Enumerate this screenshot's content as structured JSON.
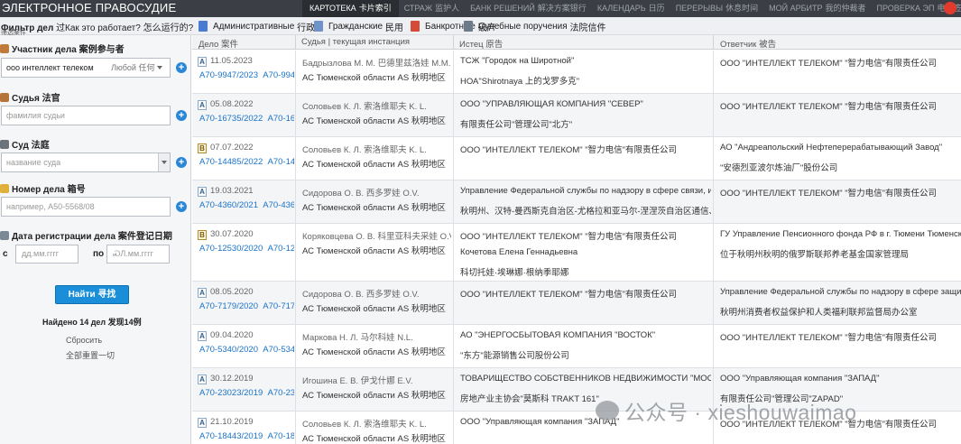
{
  "app": {
    "brand": "ЭЛЕКТРОННОЕ ПРАВОСУДИЕ",
    "topnav": [
      {
        "label": "КАРТОТЕКА",
        "zh": "卡片索引",
        "active": true
      },
      {
        "label": "СТРАЖ",
        "zh": "监护人",
        "active": false
      },
      {
        "label": "БАНК РЕШЕНИЙ",
        "zh": "解决方案银行",
        "active": false
      },
      {
        "label": "КАЛЕНДАРЬ",
        "zh": "日历",
        "active": false
      },
      {
        "label": "ПЕРЕРЫВЫ",
        "zh": "休息时间",
        "active": false
      },
      {
        "label": "МОЙ АРБИТР",
        "zh": "我的仲裁者",
        "active": false
      },
      {
        "label": "ПРОВЕРКА ЭП",
        "zh": "电子签名验证",
        "active": false
      }
    ]
  },
  "filterbar": {
    "title": "Фильтр дел",
    "title_zh": "过",
    "subtitle": "筛选案件",
    "howit": "Как это работает?",
    "howit_zh": "怎么运行的?",
    "chips": [
      {
        "label": "Административные",
        "zh": "行政",
        "color": "#4a7bd0"
      },
      {
        "label": "Гражданские",
        "zh": "民用",
        "color": "#6f93c9"
      },
      {
        "label": "Банкротные",
        "zh": "破产",
        "color": "#d64a3a"
      },
      {
        "label": "Судебные поручения",
        "zh": "法院信件",
        "color": "#6c7a8a"
      }
    ]
  },
  "sidebar": {
    "participant_label": "Участник дела",
    "participant_zh": "案例参与者",
    "participant_value": "ооо интеллект телеком",
    "participant_role": "Любой",
    "participant_role_zh": "任何",
    "judge_label": "Судья",
    "judge_zh": "法官",
    "judge_placeholder": "фамилия судьи",
    "court_label": "Суд",
    "court_zh": "法庭",
    "court_placeholder": "название суда",
    "casenum_label": "Номер дела",
    "casenum_zh": "箱号",
    "casenum_placeholder": "например, А50-5568/08",
    "date_label": "Дата регистрации дела",
    "date_zh": "案件登记日期",
    "date_from": "с",
    "date_to": "по",
    "date_placeholder": "дд.мм.гггг",
    "date_to_placeholder": "ᏍЛ.мм.гггг",
    "find_button": "Найти",
    "find_zh": "寻找",
    "found": "Найдено 14 дел",
    "found_zh": "发现14例",
    "reset": "Сбросить",
    "reset_zh": "全部重置一切",
    "reset_zh2": "全部重置一切"
  },
  "table": {
    "headers": [
      {
        "label": "Дело",
        "zh": "案件"
      },
      {
        "label": "Судья | текущая инстанция",
        "zh": ""
      },
      {
        "label": "Истец",
        "zh": "原告"
      },
      {
        "label": "Ответчик",
        "zh": "被告"
      }
    ],
    "rows": [
      {
        "type": "A",
        "date": "11.05.2023",
        "case": "А70-9947/2023",
        "case_dup": "А70-9947/2023",
        "judge": "Бадрызлова М. М.",
        "judge_zh": "巴德里兹洛娃 M.M.",
        "court": "АС Тюменской области",
        "court_zh": "AS 秋明地区",
        "plaintiff": [
          "ТСЖ \"Городок на Широтной\"",
          "НОА\"Shirotnaya 上的戈罗多克\""
        ],
        "defendant": [
          "ООО \"ИНТЕЛЛЕКТ ТЕЛЕКОМ\" \"智力电信\"有限责任公司"
        ]
      },
      {
        "type": "A",
        "date": "05.08.2022",
        "case": "А70-16735/2022",
        "case_dup": "А70-16735/2022",
        "judge": "Соловьев К. Л.",
        "judge_zh": "索洛维耶夫 K. L.",
        "court": "АС Тюменской области",
        "court_zh": "AS 秋明地区",
        "plaintiff": [
          "ООО \"УПРАВЛЯЮЩАЯ КОМПАНИЯ \"СЕВЕР\"",
          "有限责任公司\"管理公司\"北方\""
        ],
        "defendant": [
          "ООО \"ИНТЕЛЛЕКТ ТЕЛЕКОМ\" \"智力电信\"有限责任公司"
        ]
      },
      {
        "type": "B",
        "date": "07.07.2022",
        "case": "А70-14485/2022",
        "case_dup": "А70-14485/2022",
        "judge": "Соловьев К. Л.",
        "judge_zh": "索洛维耶夫 K. L.",
        "court": "АС Тюменской области",
        "court_zh": "AS 秋明地区",
        "plaintiff": [
          "ООО \"ИНТЕЛЛЕКТ ТЕЛЕКОМ\" \"智力电信\"有限责任公司"
        ],
        "defendant": [
          "АО \"Андреапольский Нефтеперерабатывающий Завод\"",
          "\"安德烈亚波尔炼油厂\"股份公司"
        ]
      },
      {
        "type": "A",
        "date": "19.03.2021",
        "case": "А70-4360/2021",
        "case_dup": "А70-4360/2021",
        "judge": "Сидорова О. В.",
        "judge_zh": "西多罗娃 O.V.",
        "court": "АС Тюменской области",
        "court_zh": "AS 秋明地区",
        "plaintiff": [
          "Управление Федеральной службы по надзору в сфере связи, информ",
          "秋明州、汉特-曼西斯克自治区-尤格拉和亚马尔-涅涅茨自治区通信、信"
        ],
        "defendant": [
          "ООО \"ИНТЕЛЛЕКТ ТЕЛЕКОМ\" \"智力电信\"有限责任公司"
        ]
      },
      {
        "type": "B",
        "date": "30.07.2020",
        "case": "А70-12530/2020",
        "case_dup": "А70-12530/2020",
        "judge": "Коряковцева О. В.",
        "judge_zh": "科里亚科夫采娃 O.V.",
        "court": "АС Тюменской области",
        "court_zh": "AS 秋明地区",
        "plaintiff": [
          "ООО \"ИНТЕЛЛЕКТ ТЕЛЕКОМ\" \"智力电信\"有限责任公司",
          "Кочетова Елена Геннадьевна",
          "科切托娃·埃琳娜·根纳季耶娜"
        ],
        "defendant": [
          "ГУ Управление Пенсионного фонда РФ в г. Тюмени Тюменской о",
          "位于秋明州秋明的俄罗斯联邦养老基金国家管理局"
        ]
      },
      {
        "type": "A",
        "date": "08.05.2020",
        "case": "А70-7179/2020",
        "case_dup": "А70-7179/2020",
        "judge": "Сидорова О. В.",
        "judge_zh": "西多罗娃 O.V.",
        "court": "АС Тюменской области",
        "court_zh": "AS 秋明地区",
        "plaintiff": [
          "ООО \"ИНТЕЛЛЕКТ ТЕЛЕКОМ\" \"智力电信\"有限责任公司"
        ],
        "defendant": [
          "Управление Федеральной службы по надзору в сфере защиты пр",
          "秋明州消费者权益保护和人类福利联邦监督局办公室"
        ]
      },
      {
        "type": "A",
        "date": "09.04.2020",
        "case": "А70-5340/2020",
        "case_dup": "А70-5340/2020",
        "judge": "Маркова Н. Л.",
        "judge_zh": "马尔科娃 N.L.",
        "court": "АС Тюменской области",
        "court_zh": "AS 秋明地区",
        "plaintiff": [
          "АО \"ЭНЕРГОСБЫТОВАЯ КОМПАНИЯ \"ВОСТОК\"",
          "\"东方\"能源销售公司股份公司"
        ],
        "defendant": [
          "ООО \"ИНТЕЛЛЕКТ ТЕЛЕКОМ\" \"智力电信\"有限责任公司"
        ]
      },
      {
        "type": "A",
        "date": "30.12.2019",
        "case": "А70-23023/2019",
        "case_dup": "А70-23023/2019",
        "judge": "Игошина Е. В.",
        "judge_zh": "伊戈什娜 E.V.",
        "court": "АС Тюменской области",
        "court_zh": "AS 秋明地区",
        "plaintiff": [
          "ТОВАРИЩЕСТВО СОБСТВЕННИКОВ НЕДВИЖИМОСТИ \"МОСКОВ",
          "房地产业主协会\"莫斯科 TRAKT 161\""
        ],
        "defendant": [
          "ООО \"Управляющая компания \"ЗАПАД\"",
          "有限责任公司\"管理公司\"ZAPAD\""
        ]
      },
      {
        "type": "A",
        "date": "21.10.2019",
        "case": "А70-18443/2019",
        "case_dup": "А70-18443/2019",
        "judge": "Соловьев К. Л.",
        "judge_zh": "索洛维耶夫 K. L.",
        "court": "АС Тюменской области",
        "court_zh": "AS 秋明地区",
        "plaintiff": [
          "ООО \"Управляющая компания \"ЗАПАД\""
        ],
        "defendant": [
          "ООО \"ИНТЕЛЛЕКТ ТЕЛЕКОМ\" \"智力电信\"有限责任公司"
        ]
      }
    ]
  },
  "watermark": {
    "text": "公众号 · xieshouwaimao"
  }
}
